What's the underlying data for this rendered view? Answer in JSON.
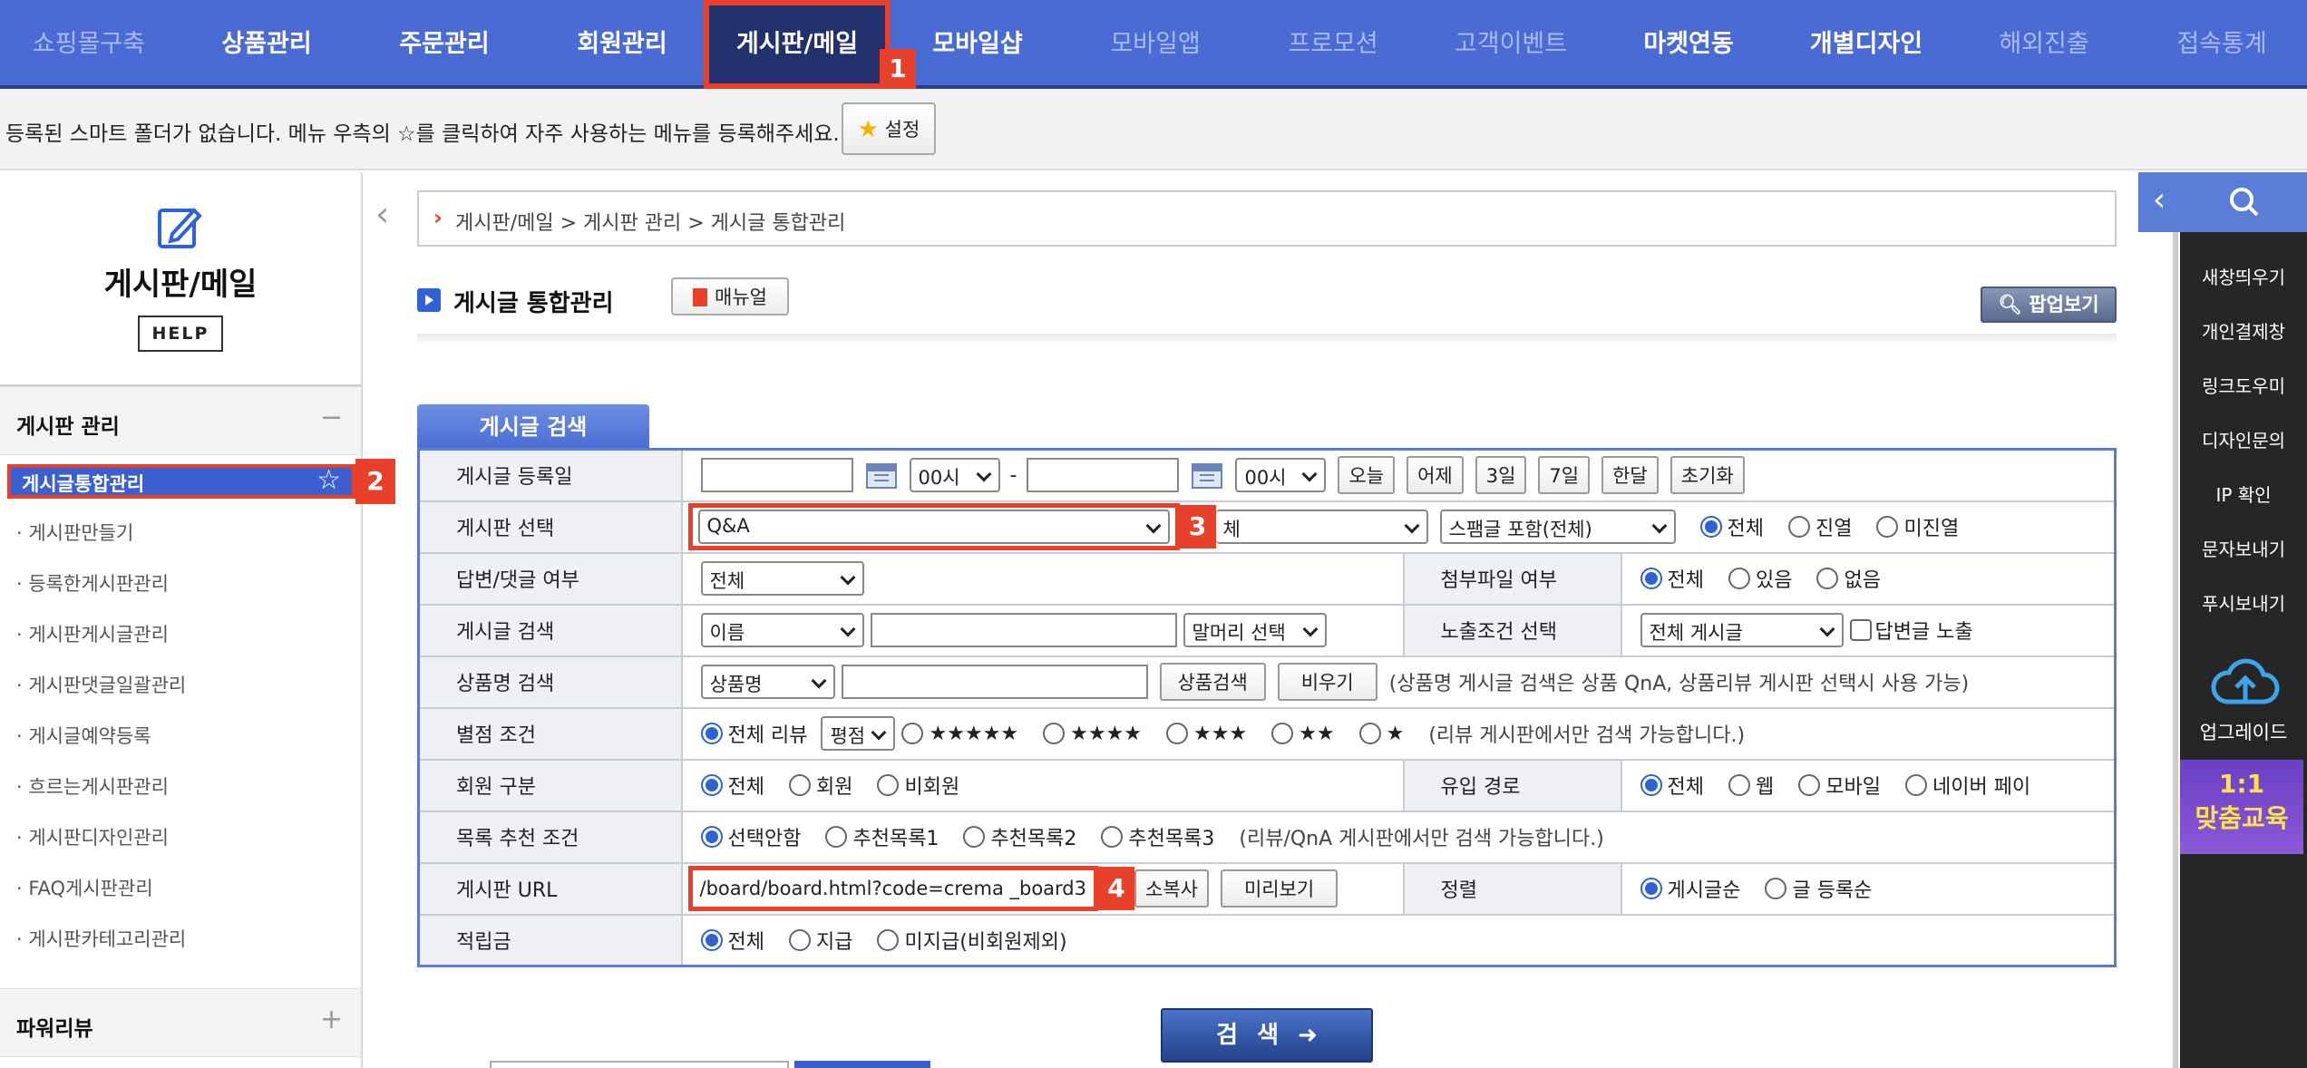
{
  "topnav": {
    "items": [
      "쇼핑몰구축",
      "상품관리",
      "주문관리",
      "회원관리",
      "게시판/메일",
      "모바일샵",
      "모바일앱",
      "프로모션",
      "고객이벤트",
      "마켓연동",
      "개별디자인",
      "해외진출",
      "접속통계"
    ]
  },
  "favbar": {
    "message": "등록된 스마트 폴더가 없습니다. 메뉴 우측의 ☆를 클릭하여 자주 사용하는 메뉴를 등록해주세요.",
    "setting_label": "설정"
  },
  "sidebar": {
    "title": "게시판/메일",
    "help_label": "HELP",
    "section1": "게시판 관리",
    "items": [
      "게시글통합관리",
      "게시판만들기",
      "등록한게시판관리",
      "게시판게시글관리",
      "게시판댓글일괄관리",
      "게시글예약등록",
      "흐르는게시판관리",
      "게시판디자인관리",
      "FAQ게시판관리",
      "게시판카테고리관리"
    ],
    "section2": "파워리뷰"
  },
  "breadcrumb": "게시판/메일 > 게시판 관리 > 게시글 통합관리",
  "page": {
    "title": "게시글 통합관리",
    "manual_label": "매뉴얼",
    "popup_label": "팝업보기",
    "search_tab": "게시글 검색",
    "search_button": "검 색"
  },
  "form": {
    "row1": {
      "label": "게시글 등록일",
      "hour1": "00시",
      "dash": "-",
      "hour2": "00시",
      "buttons": [
        "오늘",
        "어제",
        "3일",
        "7일",
        "한달",
        "초기화"
      ]
    },
    "row2": {
      "label": "게시판 선택",
      "board": "Q&A",
      "sub": "체",
      "spam": "스팸글 포함(전체)",
      "radios": [
        "전체",
        "진열",
        "미진열"
      ]
    },
    "row3": {
      "label": "답변/댓글 여부",
      "sel": "전체",
      "label2": "첨부파일 여부",
      "radios": [
        "전체",
        "있음",
        "없음"
      ]
    },
    "row4": {
      "label": "게시글 검색",
      "sel": "이름",
      "head": "말머리 선택",
      "label2": "노출조건 선택",
      "sel2": "전체 게시글",
      "check": "답변글 노출"
    },
    "row5": {
      "label": "상품명 검색",
      "sel": "상품명",
      "btn1": "상품검색",
      "btn2": "비우기",
      "note": "(상품명 게시글 검색은 상품 QnA, 상품리뷰 게시판 선택시 사용 가능)"
    },
    "row6": {
      "label": "별점 조건",
      "all": "전체 리뷰",
      "sel": "평점",
      "stars": [
        "★★★★★",
        "★★★★",
        "★★★",
        "★★",
        "★"
      ],
      "note": "(리뷰 게시판에서만 검색 가능합니다.)"
    },
    "row7": {
      "label": "회원 구분",
      "radios": [
        "전체",
        "회원",
        "비회원"
      ],
      "label2": "유입 경로",
      "radios2": [
        "전체",
        "웹",
        "모바일",
        "네이버 페이"
      ]
    },
    "row8": {
      "label": "목록 추천 조건",
      "radios": [
        "선택안함",
        "추천목록1",
        "추천목록2",
        "추천목록3"
      ],
      "note": "(리뷰/QnA 게시판에서만 검색 가능합니다.)"
    },
    "row9": {
      "label": "게시판 URL",
      "url": "/board/board.html?code=",
      "url2": "crema _board3",
      "btn1": "소복사",
      "btn2": "미리보기",
      "label2": "정렬",
      "radios": [
        "게시글순",
        "글 등록순"
      ]
    },
    "row10": {
      "label": "적립금",
      "radios": [
        "전체",
        "지급",
        "미지급(비회원제외)"
      ]
    }
  },
  "right_panel": {
    "items": [
      "새창띄우기",
      "개인결제창",
      "링크도우미",
      "디자인문의",
      "IP 확인",
      "문자보내기",
      "푸시보내기"
    ],
    "upgrade": "업그레이드",
    "edu_line1": "1:1",
    "edu_line2": "맞춤교육"
  },
  "badges": [
    "1",
    "2",
    "3",
    "4"
  ],
  "colors": {
    "nav": "#4a6bd4",
    "highlight": "#e8412b",
    "accent": "#2f62d6"
  }
}
